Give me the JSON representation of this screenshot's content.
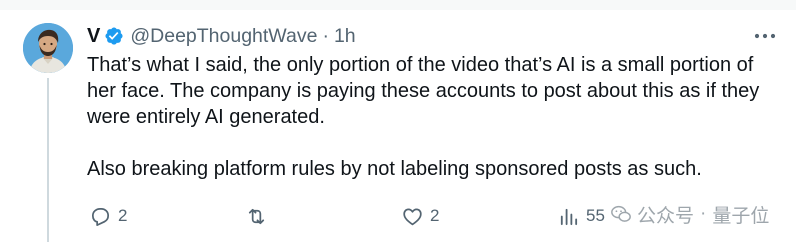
{
  "tweet": {
    "display_name": "V",
    "handle": "@DeepThoughtWave",
    "separator": "·",
    "time": "1h",
    "text": [
      "That’s what I said, the only portion of the video that’s AI is a small portion of her face. The company is paying these accounts to post about this as if they were entirely AI generated.",
      "Also breaking platform rules by not labeling sponsored posts as such."
    ],
    "verified": true
  },
  "actions": {
    "replies": "2",
    "retweets": "",
    "likes": "2",
    "views": "55"
  },
  "watermark": {
    "brand": "公众号",
    "dot": "·",
    "name": "量子位"
  },
  "colors": {
    "accent": "#1d9bf0",
    "muted": "#536471",
    "text": "#0f1419",
    "line": "#cfd9de"
  }
}
